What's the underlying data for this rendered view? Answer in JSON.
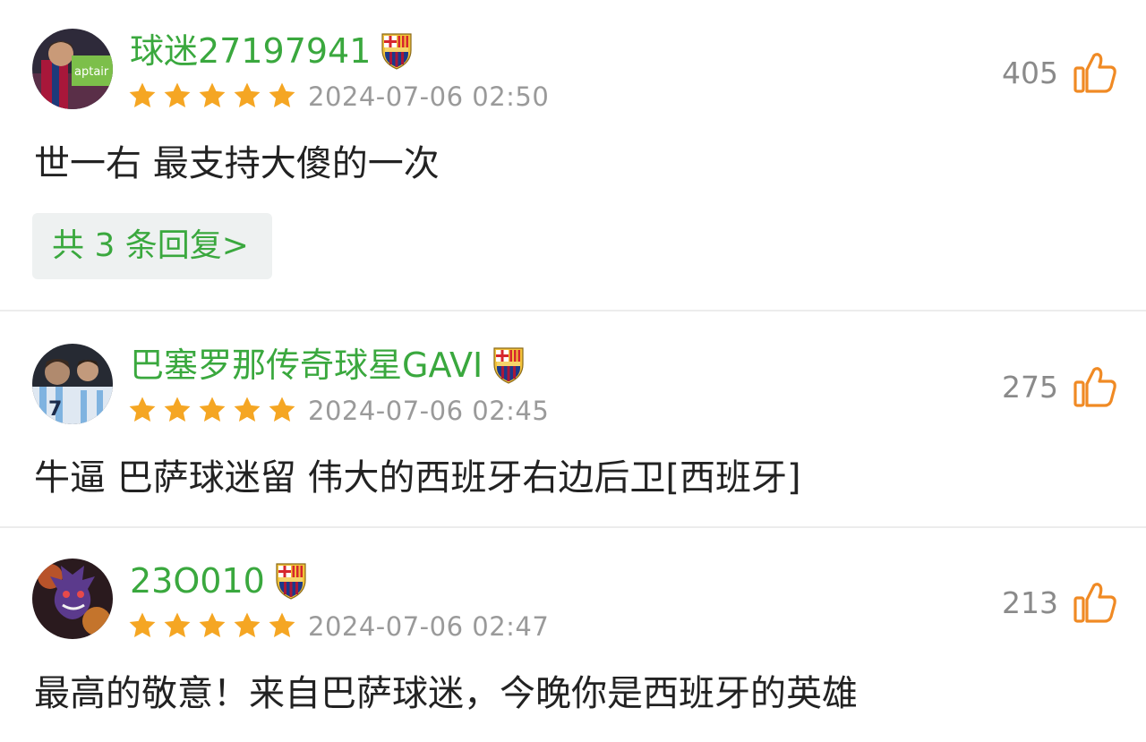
{
  "comments": [
    {
      "username": "球迷27197941",
      "rating": 5,
      "date": "2024-07-06 02:50",
      "likes": "405",
      "text": "世一右 最支持大傻的一次",
      "replies": "共 3 条回复>",
      "avatar_label": "aptair"
    },
    {
      "username": "巴塞罗那传奇球星GAVI",
      "rating": 5,
      "date": "2024-07-06 02:45",
      "likes": "275",
      "text": "牛逼 巴萨球迷留 伟大的西班牙右边后卫[西班牙]"
    },
    {
      "username": "23O010",
      "rating": 5,
      "date": "2024-07-06 02:47",
      "likes": "213",
      "text": "最高的敬意！来自巴萨球迷，今晚你是西班牙的英雄"
    }
  ],
  "colors": {
    "username": "#3aa83e",
    "star": "#f5a623",
    "like_icon": "#f08a24",
    "date": "#9a9a9a"
  },
  "icons": {
    "badge": "fc-barcelona-crest-icon",
    "star": "star-icon",
    "like": "thumbs-up-icon"
  }
}
